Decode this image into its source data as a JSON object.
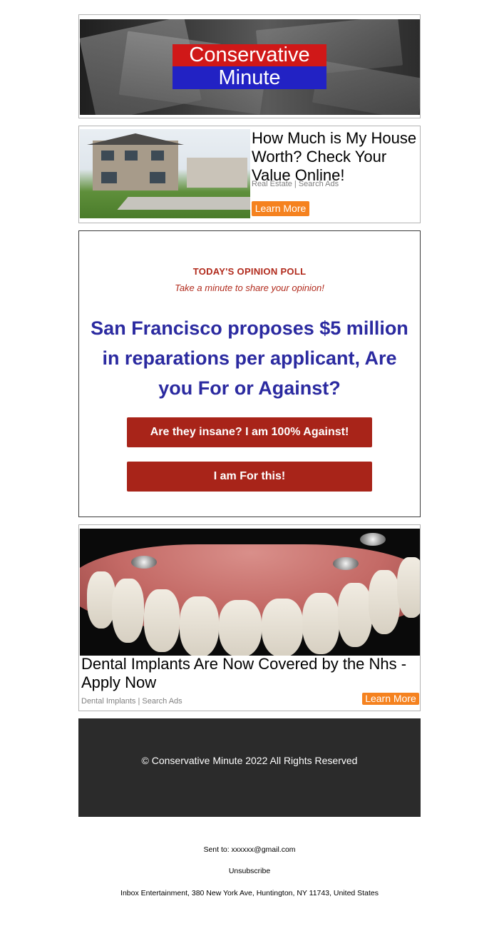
{
  "header": {
    "logo_line1": "Conservative",
    "logo_line2": "Minute",
    "colors": {
      "logo_red": "#d01818",
      "logo_blue": "#2222c4"
    }
  },
  "ad_house": {
    "title": "How Much is My House Worth? Check Your Value Online!",
    "meta": "Real Estate | Search Ads",
    "button": "Learn More"
  },
  "poll": {
    "kicker": "TODAY'S OPINION POLL",
    "subtitle": "Take a minute to share your opinion!",
    "question": "San Francisco proposes $5 million in reparations per applicant, Are you For or Against?",
    "option_against": "Are they insane? I am 100% Against!",
    "option_for": "I am For this!",
    "colors": {
      "accent": "#a82419",
      "question": "#2b2aa0"
    }
  },
  "ad_dental": {
    "title": "Dental Implants Are Now Covered by the Nhs - Apply Now",
    "meta": "Dental Implants | Search Ads",
    "button": "Learn More",
    "colors": {
      "button": "#f5821f"
    }
  },
  "footer": {
    "copyright": "© Conservative Minute 2022 All Rights Reserved"
  },
  "bottom": {
    "sent_to": "Sent to: xxxxxx@gmail.com",
    "unsubscribe": "Unsubscribe",
    "address": "Inbox Entertainment, 380 New York Ave, Huntington, NY 11743, United States"
  }
}
